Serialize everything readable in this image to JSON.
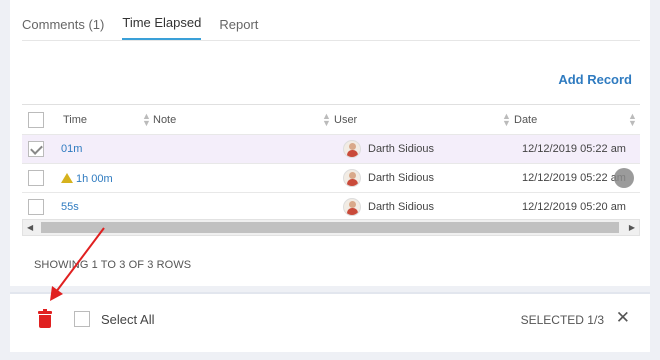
{
  "tabs": [
    {
      "label": "Comments (1)",
      "active": false
    },
    {
      "label": "Time Elapsed",
      "active": true
    },
    {
      "label": "Report",
      "active": false
    }
  ],
  "add_record": "Add Record",
  "table": {
    "columns": [
      "Time",
      "Note",
      "User",
      "Date"
    ],
    "rows": [
      {
        "time": "01m",
        "note": "",
        "user": "Darth Sidious",
        "date": "12/12/2019 05:22 am",
        "checked": true,
        "warning": false
      },
      {
        "time": "1h 00m",
        "note": "",
        "user": "Darth Sidious",
        "date": "12/12/2019 05:22 am",
        "checked": false,
        "warning": true
      },
      {
        "time": "55s",
        "note": "",
        "user": "Darth Sidious",
        "date": "12/12/2019 05:20 am",
        "checked": false,
        "warning": false
      }
    ]
  },
  "showing": "SHOWING 1 TO 3 OF 3 ROWS",
  "footer": {
    "select_all": "Select All",
    "selected": "SELECTED 1/3"
  },
  "colors": {
    "accent": "#3aa0d8",
    "link": "#2f7bc0",
    "danger": "#e02020",
    "selected_row": "#f4eefa",
    "warning": "#d6b21e"
  }
}
